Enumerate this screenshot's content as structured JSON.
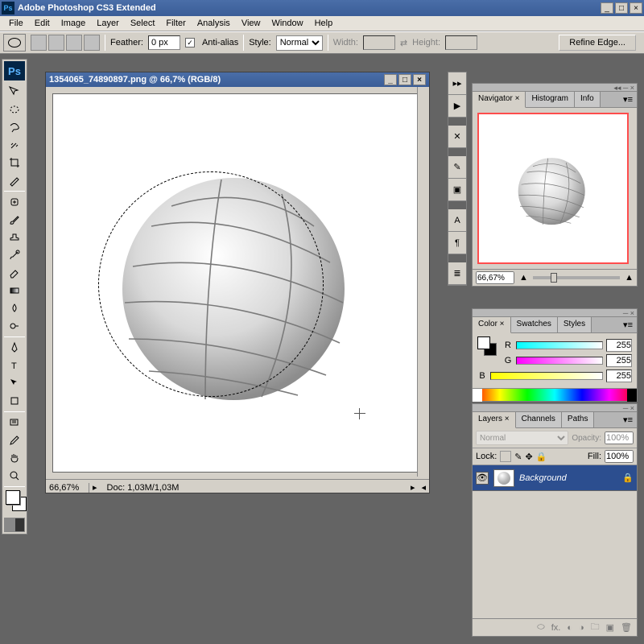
{
  "app": {
    "title": "Adobe Photoshop CS3 Extended"
  },
  "menu": [
    "File",
    "Edit",
    "Image",
    "Layer",
    "Select",
    "Filter",
    "Analysis",
    "View",
    "Window",
    "Help"
  ],
  "options": {
    "featherLabel": "Feather:",
    "featherValue": "0 px",
    "antialiasLabel": "Anti-alias",
    "styleLabel": "Style:",
    "styleValue": "Normal",
    "widthLabel": "Width:",
    "heightLabel": "Height:",
    "refineLabel": "Refine Edge..."
  },
  "document": {
    "title": "1354065_74890897.png @ 66,7% (RGB/8)",
    "zoom": "66,67%",
    "status": "Doc: 1,03M/1,03M"
  },
  "navigator": {
    "tabs": [
      "Navigator",
      "Histogram",
      "Info"
    ],
    "zoom": "66,67%"
  },
  "color": {
    "tabs": [
      "Color",
      "Swatches",
      "Styles"
    ],
    "channels": [
      {
        "label": "R",
        "value": "255"
      },
      {
        "label": "G",
        "value": "255"
      },
      {
        "label": "B",
        "value": "255"
      }
    ]
  },
  "layers": {
    "tabs": [
      "Layers",
      "Channels",
      "Paths"
    ],
    "blend": "Normal",
    "opacityLabel": "Opacity:",
    "opacity": "100%",
    "lockLabel": "Lock:",
    "fillLabel": "Fill:",
    "fill": "100%",
    "items": [
      {
        "name": "Background"
      }
    ]
  }
}
